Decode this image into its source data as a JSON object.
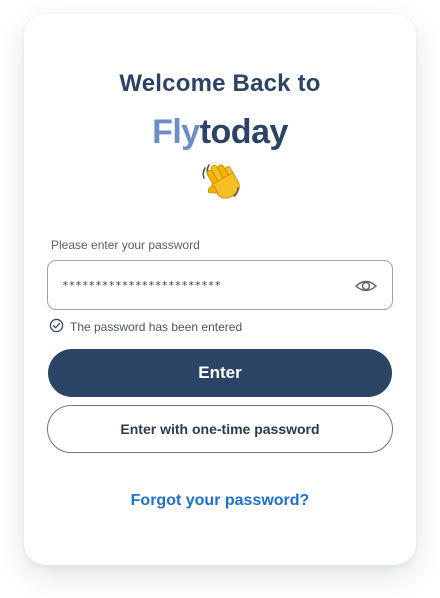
{
  "header": {
    "welcome_text": "Welcome Back to",
    "brand_part1": "Fly",
    "brand_part2": "today",
    "wave_icon": "waving-hand-emoji"
  },
  "password": {
    "label": "Please enter your password",
    "value": "************************",
    "toggle_icon": "eye-icon",
    "status_icon": "check-circle-icon",
    "status_text": "The password has been entered"
  },
  "actions": {
    "enter_label": "Enter",
    "otp_label": "Enter with one-time password",
    "forgot_label": "Forgot your password?"
  },
  "colors": {
    "navy": "#2c4566",
    "brand_light": "#6b8ec7",
    "link": "#1f6fcf"
  }
}
